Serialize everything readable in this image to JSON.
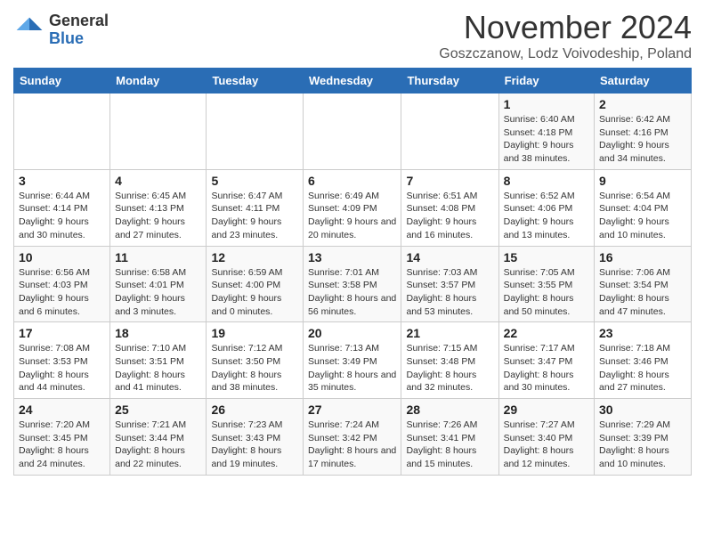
{
  "header": {
    "logo_general": "General",
    "logo_blue": "Blue",
    "month_title": "November 2024",
    "subtitle": "Goszczanow, Lodz Voivodeship, Poland"
  },
  "weekdays": [
    "Sunday",
    "Monday",
    "Tuesday",
    "Wednesday",
    "Thursday",
    "Friday",
    "Saturday"
  ],
  "weeks": [
    [
      {
        "num": "",
        "sunrise": "",
        "sunset": "",
        "daylight": ""
      },
      {
        "num": "",
        "sunrise": "",
        "sunset": "",
        "daylight": ""
      },
      {
        "num": "",
        "sunrise": "",
        "sunset": "",
        "daylight": ""
      },
      {
        "num": "",
        "sunrise": "",
        "sunset": "",
        "daylight": ""
      },
      {
        "num": "",
        "sunrise": "",
        "sunset": "",
        "daylight": ""
      },
      {
        "num": "1",
        "sunrise": "Sunrise: 6:40 AM",
        "sunset": "Sunset: 4:18 PM",
        "daylight": "Daylight: 9 hours and 38 minutes."
      },
      {
        "num": "2",
        "sunrise": "Sunrise: 6:42 AM",
        "sunset": "Sunset: 4:16 PM",
        "daylight": "Daylight: 9 hours and 34 minutes."
      }
    ],
    [
      {
        "num": "3",
        "sunrise": "Sunrise: 6:44 AM",
        "sunset": "Sunset: 4:14 PM",
        "daylight": "Daylight: 9 hours and 30 minutes."
      },
      {
        "num": "4",
        "sunrise": "Sunrise: 6:45 AM",
        "sunset": "Sunset: 4:13 PM",
        "daylight": "Daylight: 9 hours and 27 minutes."
      },
      {
        "num": "5",
        "sunrise": "Sunrise: 6:47 AM",
        "sunset": "Sunset: 4:11 PM",
        "daylight": "Daylight: 9 hours and 23 minutes."
      },
      {
        "num": "6",
        "sunrise": "Sunrise: 6:49 AM",
        "sunset": "Sunset: 4:09 PM",
        "daylight": "Daylight: 9 hours and 20 minutes."
      },
      {
        "num": "7",
        "sunrise": "Sunrise: 6:51 AM",
        "sunset": "Sunset: 4:08 PM",
        "daylight": "Daylight: 9 hours and 16 minutes."
      },
      {
        "num": "8",
        "sunrise": "Sunrise: 6:52 AM",
        "sunset": "Sunset: 4:06 PM",
        "daylight": "Daylight: 9 hours and 13 minutes."
      },
      {
        "num": "9",
        "sunrise": "Sunrise: 6:54 AM",
        "sunset": "Sunset: 4:04 PM",
        "daylight": "Daylight: 9 hours and 10 minutes."
      }
    ],
    [
      {
        "num": "10",
        "sunrise": "Sunrise: 6:56 AM",
        "sunset": "Sunset: 4:03 PM",
        "daylight": "Daylight: 9 hours and 6 minutes."
      },
      {
        "num": "11",
        "sunrise": "Sunrise: 6:58 AM",
        "sunset": "Sunset: 4:01 PM",
        "daylight": "Daylight: 9 hours and 3 minutes."
      },
      {
        "num": "12",
        "sunrise": "Sunrise: 6:59 AM",
        "sunset": "Sunset: 4:00 PM",
        "daylight": "Daylight: 9 hours and 0 minutes."
      },
      {
        "num": "13",
        "sunrise": "Sunrise: 7:01 AM",
        "sunset": "Sunset: 3:58 PM",
        "daylight": "Daylight: 8 hours and 56 minutes."
      },
      {
        "num": "14",
        "sunrise": "Sunrise: 7:03 AM",
        "sunset": "Sunset: 3:57 PM",
        "daylight": "Daylight: 8 hours and 53 minutes."
      },
      {
        "num": "15",
        "sunrise": "Sunrise: 7:05 AM",
        "sunset": "Sunset: 3:55 PM",
        "daylight": "Daylight: 8 hours and 50 minutes."
      },
      {
        "num": "16",
        "sunrise": "Sunrise: 7:06 AM",
        "sunset": "Sunset: 3:54 PM",
        "daylight": "Daylight: 8 hours and 47 minutes."
      }
    ],
    [
      {
        "num": "17",
        "sunrise": "Sunrise: 7:08 AM",
        "sunset": "Sunset: 3:53 PM",
        "daylight": "Daylight: 8 hours and 44 minutes."
      },
      {
        "num": "18",
        "sunrise": "Sunrise: 7:10 AM",
        "sunset": "Sunset: 3:51 PM",
        "daylight": "Daylight: 8 hours and 41 minutes."
      },
      {
        "num": "19",
        "sunrise": "Sunrise: 7:12 AM",
        "sunset": "Sunset: 3:50 PM",
        "daylight": "Daylight: 8 hours and 38 minutes."
      },
      {
        "num": "20",
        "sunrise": "Sunrise: 7:13 AM",
        "sunset": "Sunset: 3:49 PM",
        "daylight": "Daylight: 8 hours and 35 minutes."
      },
      {
        "num": "21",
        "sunrise": "Sunrise: 7:15 AM",
        "sunset": "Sunset: 3:48 PM",
        "daylight": "Daylight: 8 hours and 32 minutes."
      },
      {
        "num": "22",
        "sunrise": "Sunrise: 7:17 AM",
        "sunset": "Sunset: 3:47 PM",
        "daylight": "Daylight: 8 hours and 30 minutes."
      },
      {
        "num": "23",
        "sunrise": "Sunrise: 7:18 AM",
        "sunset": "Sunset: 3:46 PM",
        "daylight": "Daylight: 8 hours and 27 minutes."
      }
    ],
    [
      {
        "num": "24",
        "sunrise": "Sunrise: 7:20 AM",
        "sunset": "Sunset: 3:45 PM",
        "daylight": "Daylight: 8 hours and 24 minutes."
      },
      {
        "num": "25",
        "sunrise": "Sunrise: 7:21 AM",
        "sunset": "Sunset: 3:44 PM",
        "daylight": "Daylight: 8 hours and 22 minutes."
      },
      {
        "num": "26",
        "sunrise": "Sunrise: 7:23 AM",
        "sunset": "Sunset: 3:43 PM",
        "daylight": "Daylight: 8 hours and 19 minutes."
      },
      {
        "num": "27",
        "sunrise": "Sunrise: 7:24 AM",
        "sunset": "Sunset: 3:42 PM",
        "daylight": "Daylight: 8 hours and 17 minutes."
      },
      {
        "num": "28",
        "sunrise": "Sunrise: 7:26 AM",
        "sunset": "Sunset: 3:41 PM",
        "daylight": "Daylight: 8 hours and 15 minutes."
      },
      {
        "num": "29",
        "sunrise": "Sunrise: 7:27 AM",
        "sunset": "Sunset: 3:40 PM",
        "daylight": "Daylight: 8 hours and 12 minutes."
      },
      {
        "num": "30",
        "sunrise": "Sunrise: 7:29 AM",
        "sunset": "Sunset: 3:39 PM",
        "daylight": "Daylight: 8 hours and 10 minutes."
      }
    ]
  ]
}
